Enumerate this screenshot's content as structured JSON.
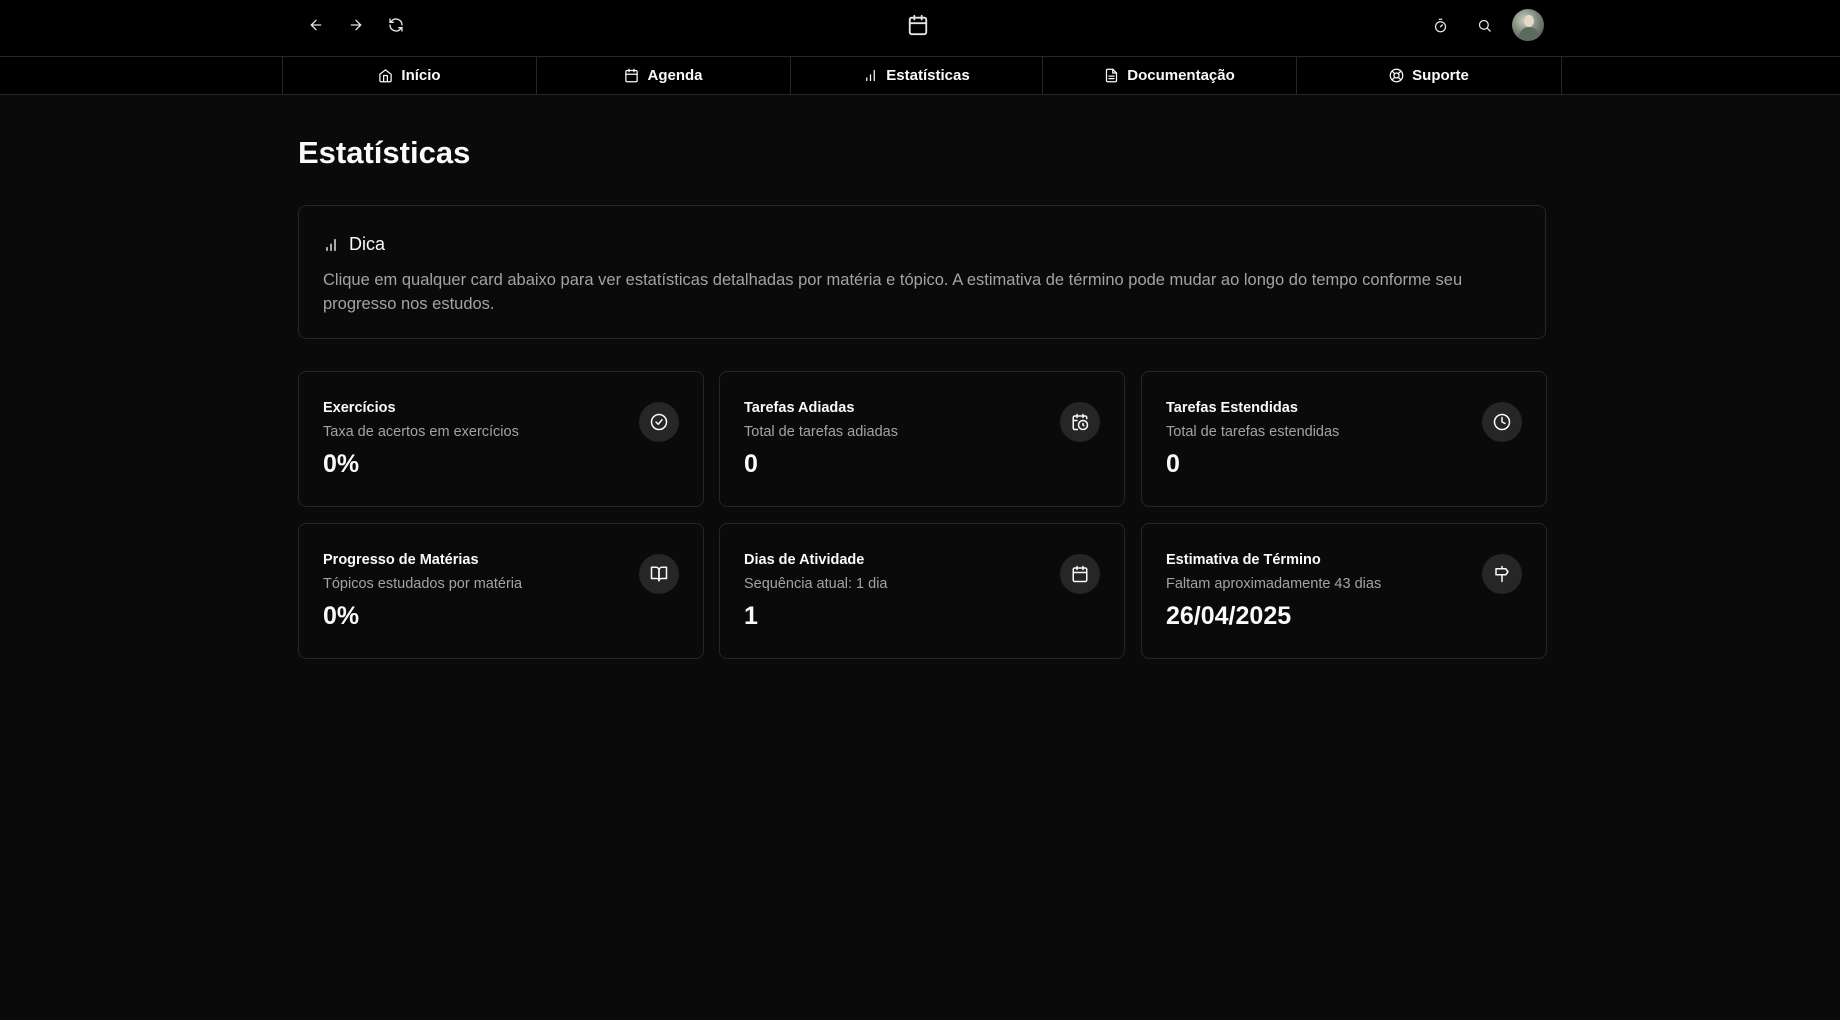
{
  "topbar": {
    "back_icon": "arrow-left-icon",
    "forward_icon": "arrow-right-icon",
    "refresh_icon": "refresh-icon",
    "center_icon": "calendar-icon",
    "timer_icon": "stopwatch-icon",
    "search_icon": "search-icon",
    "avatar": "user-avatar"
  },
  "nav": {
    "items": [
      {
        "label": "Início",
        "icon": "home-icon"
      },
      {
        "label": "Agenda",
        "icon": "calendar-icon"
      },
      {
        "label": "Estatísticas",
        "icon": "bar-chart-icon"
      },
      {
        "label": "Documentação",
        "icon": "document-icon"
      },
      {
        "label": "Suporte",
        "icon": "lifebuoy-icon"
      }
    ]
  },
  "page": {
    "title": "Estatísticas"
  },
  "tip": {
    "title": "Dica",
    "icon": "bar-chart-icon",
    "text": "Clique em qualquer card abaixo para ver estatísticas detalhadas por matéria e tópico. A estimativa de término pode mudar ao longo do tempo conforme seu progresso nos estudos."
  },
  "cards": [
    {
      "title": "Exercícios",
      "subtitle": "Taxa de acertos em exercícios",
      "value": "0%",
      "icon": "check-circle-icon"
    },
    {
      "title": "Tarefas Adiadas",
      "subtitle": "Total de tarefas adiadas",
      "value": "0",
      "icon": "calendar-clock-icon"
    },
    {
      "title": "Tarefas Estendidas",
      "subtitle": "Total de tarefas estendidas",
      "value": "0",
      "icon": "clock-icon"
    },
    {
      "title": "Progresso de Matérias",
      "subtitle": "Tópicos estudados por matéria",
      "value": "0%",
      "icon": "book-open-icon"
    },
    {
      "title": "Dias de Atividade",
      "subtitle": "Sequência atual: 1 dia",
      "value": "1",
      "icon": "calendar-icon"
    },
    {
      "title": "Estimativa de Término",
      "subtitle": "Faltam aproximadamente 43 dias",
      "value": "26/04/2025",
      "icon": "signpost-icon"
    }
  ],
  "colors": {
    "background": "#0a0a0a",
    "bar": "#000000",
    "border": "#262626",
    "text": "#fafafa",
    "muted": "#a3a3a3",
    "icon_bg": "#262626"
  }
}
